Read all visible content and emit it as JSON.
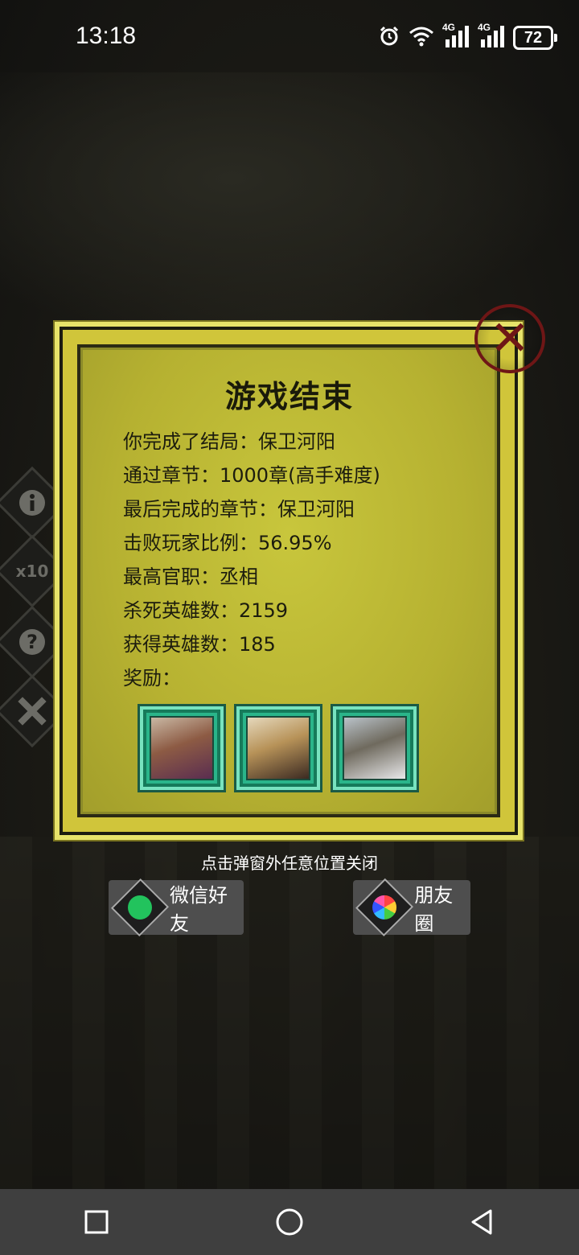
{
  "status_bar": {
    "time": "13:18",
    "network_label_1": "4G",
    "network_label_2": "4G",
    "battery": "72",
    "icons": [
      "alarm-icon",
      "wifi-icon",
      "signal-icon",
      "signal-icon",
      "battery-icon"
    ]
  },
  "side_icons": [
    {
      "name": "info-icon",
      "label": "i"
    },
    {
      "name": "speed-x10-icon",
      "label": "x10"
    },
    {
      "name": "help-icon",
      "label": "?"
    },
    {
      "name": "close-icon",
      "label": "✕"
    }
  ],
  "dialog": {
    "title": "游戏结束",
    "stats": [
      "你完成了结局：保卫河阳",
      "通过章节：1000章(高手难度)",
      "最后完成的章节：保卫河阳",
      "击败玩家比例：56.95%",
      "最高官职：丞相",
      "杀死英雄数：2159",
      "获得英雄数：185",
      "奖励："
    ],
    "rewards": [
      {
        "portrait": "archer-general-portrait"
      },
      {
        "portrait": "armored-general-portrait"
      },
      {
        "portrait": "white-robed-general-portrait"
      }
    ],
    "close_icon": "close-icon"
  },
  "tap_hint": "点击弹窗外任意位置关闭",
  "share": {
    "wechat_label": "微信好友",
    "moments_label": "朋友圈"
  },
  "colors": {
    "panel": "#b6b131",
    "reward_frame": "#2ab58a",
    "close_red": "#6e1616"
  }
}
